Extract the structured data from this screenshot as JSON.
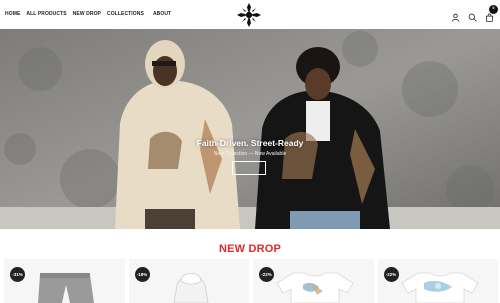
{
  "nav": {
    "items": [
      {
        "label": "HOME"
      },
      {
        "label": "ALL PRODUCTS"
      },
      {
        "label": "NEW DROP"
      },
      {
        "label": "COLLECTIONS"
      },
      {
        "label": "ABOUT"
      }
    ]
  },
  "header": {
    "logo_icon": "cross-emblem-logo",
    "icons": [
      "user-icon",
      "search-icon",
      "cart-icon"
    ],
    "cart_count": "0"
  },
  "hero": {
    "title": "Faith-Driven. Street-Ready",
    "subtitle": "New Collection — Now Available",
    "button_label": ""
  },
  "section": {
    "title": "NEW DROP"
  },
  "products": [
    {
      "badge": "-31%",
      "type": "sweatpants"
    },
    {
      "badge": "-18%",
      "type": "hoodie"
    },
    {
      "badge": "-22%",
      "type": "graphic-tee"
    },
    {
      "badge": "-22%",
      "type": "graphic-tee"
    }
  ],
  "colors": {
    "accent": "#e0282a",
    "badge": "#222222"
  }
}
